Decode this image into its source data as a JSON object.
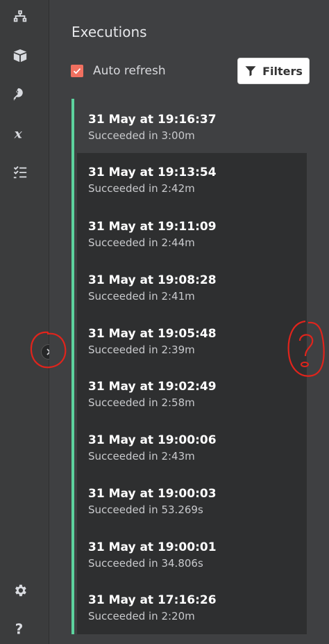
{
  "sidebar": {
    "items": [
      {
        "icon": "network-icon"
      },
      {
        "icon": "box-icon"
      },
      {
        "icon": "key-icon"
      },
      {
        "icon": "variable-x-icon"
      },
      {
        "icon": "checklist-icon"
      }
    ],
    "bottom": [
      {
        "icon": "gear-icon"
      },
      {
        "icon": "help-icon"
      }
    ]
  },
  "header": {
    "title": "Executions"
  },
  "controls": {
    "auto_refresh_label": "Auto refresh",
    "auto_refresh_checked": true,
    "filters_label": "Filters"
  },
  "executions": [
    {
      "timestamp": "31 May at 19:16:37",
      "status": "Succeeded in 3:00m"
    },
    {
      "timestamp": "31 May at 19:13:54",
      "status": "Succeeded in 2:42m"
    },
    {
      "timestamp": "31 May at 19:11:09",
      "status": "Succeeded in 2:44m"
    },
    {
      "timestamp": "31 May at 19:08:28",
      "status": "Succeeded in 2:41m"
    },
    {
      "timestamp": "31 May at 19:05:48",
      "status": "Succeeded in 2:39m"
    },
    {
      "timestamp": "31 May at 19:02:49",
      "status": "Succeeded in 2:58m"
    },
    {
      "timestamp": "31 May at 19:00:06",
      "status": "Succeeded in 2:43m"
    },
    {
      "timestamp": "31 May at 19:00:03",
      "status": "Succeeded in 53.269s"
    },
    {
      "timestamp": "31 May at 19:00:01",
      "status": "Succeeded in 34.806s"
    },
    {
      "timestamp": "31 May at 17:16:26",
      "status": "Succeeded in 2:20m"
    }
  ],
  "colors": {
    "accent_success": "#5dd39e",
    "checkbox": "#f07060",
    "annotation": "#e0241c"
  }
}
